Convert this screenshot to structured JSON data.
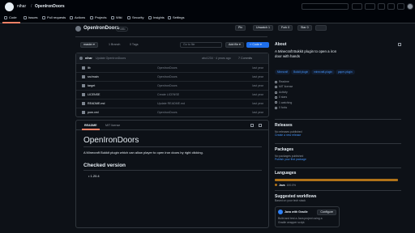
{
  "header": {
    "owner": "nihar",
    "sep": "/",
    "repo": "OpenIronDoors"
  },
  "tabs": [
    {
      "label": "Code"
    },
    {
      "label": "Issues"
    },
    {
      "label": "Pull requests"
    },
    {
      "label": "Actions"
    },
    {
      "label": "Projects"
    },
    {
      "label": "Wiki"
    },
    {
      "label": "Security"
    },
    {
      "label": "Insights"
    },
    {
      "label": "Settings"
    }
  ],
  "repo": {
    "name": "OpenIronDoors",
    "visibility": "Public",
    "pin": "Pin",
    "unwatch": "Unwatch",
    "watch_count": "1",
    "fork": "Fork",
    "fork_count": "0",
    "star": "Star",
    "star_count": "0"
  },
  "toolbar": {
    "branch": "master",
    "branches": "1 Branch",
    "tags": "0 Tags",
    "search_placeholder": "Go to file",
    "add_file": "Add file",
    "code": "Code"
  },
  "commit": {
    "author": "nihar",
    "message": "Update OpenIronDoors",
    "hash": "abc1234 · 4 years ago",
    "count": "7 Commits"
  },
  "files": [
    {
      "name": "lib",
      ".": "",
      "msg": "OpenIronDoors",
      "date": "last year"
    },
    {
      "name": "src/main",
      "msg": "OpenIronDoors",
      "date": "last year"
    },
    {
      "name": "target",
      "msg": "OpenIronDoors",
      "date": "last year"
    },
    {
      "name": "LICENSE",
      "msg": "Create LICENSE",
      "date": "last year"
    },
    {
      "name": "README.md",
      "msg": "Update README.md",
      "date": "last year"
    },
    {
      "name": "pom.xml",
      "msg": "OpenIronDoors",
      "date": "last year"
    }
  ],
  "readme": {
    "tab1": "README",
    "tab2": "MIT license",
    "title": "OpenIronDoors",
    "desc": "A Minecraft Bukkit plugin which can allow player to open iron doors by right clicking.",
    "h2": "Checked version",
    "items": [
      "1.20.4"
    ]
  },
  "about": {
    "title": "About",
    "desc": "A Minecraft Bukkit plugin to open a iron door with hands",
    "topics": [
      "Minecraft",
      "Bukkit plugin",
      "minecraft-plugin",
      "paper-plugin"
    ],
    "meta": [
      "Readme",
      "MIT license",
      "Activity",
      "0 stars",
      "1 watching",
      "0 forks"
    ]
  },
  "releases": {
    "title": "Releases",
    "text": "No releases published",
    "link": "Create a new release"
  },
  "packages": {
    "title": "Packages",
    "text": "No packages published",
    "link": "Publish your first package"
  },
  "languages": {
    "title": "Languages",
    "lang": "Java",
    "pct": "100.0%",
    "color": "#b07219"
  },
  "workflows": {
    "title": "Suggested workflows",
    "sub": "Based on your tech stack",
    "name": "Java with Gradle",
    "action": "Configure",
    "desc": "Build and test a Java project using a Gradle wrapper script."
  }
}
